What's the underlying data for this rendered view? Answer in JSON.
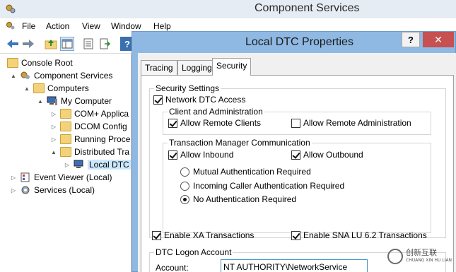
{
  "window": {
    "title": "Component Services",
    "menu": [
      "File",
      "Action",
      "View",
      "Window",
      "Help"
    ]
  },
  "tree": {
    "items": [
      {
        "label": "Console Root",
        "expander": ""
      },
      {
        "label": "Component Services",
        "expander": "▲"
      },
      {
        "label": "Computers",
        "expander": "▲"
      },
      {
        "label": "My Computer",
        "expander": "▲"
      },
      {
        "label": "COM+ Applica",
        "expander": "▷"
      },
      {
        "label": "DCOM Config",
        "expander": "▷"
      },
      {
        "label": "Running Proce",
        "expander": "▷"
      },
      {
        "label": "Distributed Tra",
        "expander": "▲"
      },
      {
        "label": "Local DTC",
        "expander": "▷"
      },
      {
        "label": "Event Viewer (Local)",
        "expander": "▷"
      },
      {
        "label": "Services (Local)",
        "expander": "▷"
      }
    ]
  },
  "dialog": {
    "title": "Local DTC Properties",
    "help_label": "?",
    "close_label": "✕",
    "tabs": [
      "Tracing",
      "Logging",
      "Security"
    ],
    "security": {
      "group_title": "Security Settings",
      "network_dtc_access": {
        "label": "Network DTC Access",
        "checked": true
      },
      "client_admin": {
        "title": "Client and Administration",
        "allow_remote_clients": {
          "label": "Allow Remote Clients",
          "checked": true
        },
        "allow_remote_admin": {
          "label": "Allow Remote Administration",
          "checked": false
        }
      },
      "tm_comm": {
        "title": "Transaction Manager Communication",
        "allow_inbound": {
          "label": "Allow Inbound",
          "checked": true
        },
        "allow_outbound": {
          "label": "Allow Outbound",
          "checked": true
        },
        "auth_options": [
          {
            "label": "Mutual Authentication Required",
            "selected": false
          },
          {
            "label": "Incoming Caller Authentication Required",
            "selected": false
          },
          {
            "label": "No Authentication Required",
            "selected": true
          }
        ]
      },
      "enable_xa": {
        "label": "Enable XA Transactions",
        "checked": true
      },
      "enable_sna": {
        "label": "Enable SNA LU 6.2 Transactions",
        "checked": true
      },
      "logon": {
        "title": "DTC Logon Account",
        "account_label": "Account:",
        "account_value": "NT AUTHORITY\\NetworkService"
      }
    }
  },
  "watermark": {
    "line1": "创新互联",
    "line2": "CHUANG XIN HU LIAN"
  }
}
